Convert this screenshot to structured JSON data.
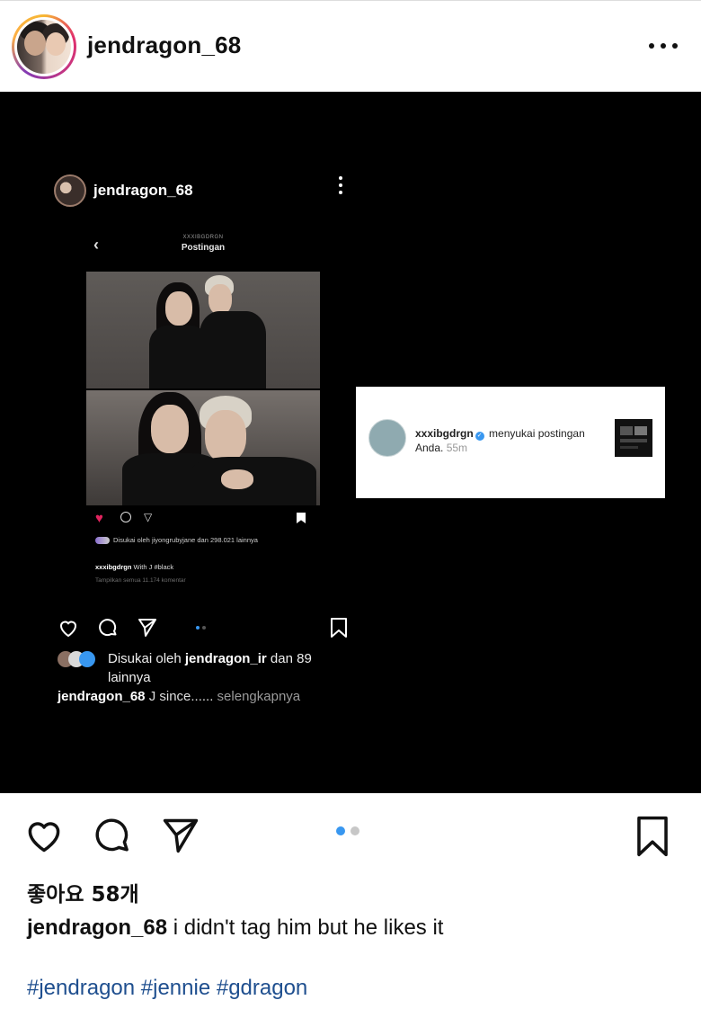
{
  "post": {
    "username": "jendragon_68",
    "likes_text": "좋아요 58개",
    "caption_user": "jendragon_68",
    "caption_text": " i didn't tag him but he likes it",
    "hashtags": "#jendragon #jennie #gdragon",
    "carousel": {
      "count": 2,
      "active": 0
    }
  },
  "inner_post": {
    "username": "jendragon_68",
    "likes_prefix": "Disukai oleh ",
    "likes_user": "jendragon_ir",
    "likes_suffix": " dan 89 lainnya",
    "caption_user": "jendragon_68",
    "caption_text": " J since......",
    "more_label": " selengkapnya"
  },
  "screenshot": {
    "account_label": "XXXIBGDRGN",
    "title": "Postingan",
    "likes_text": "Disukai oleh jiyongrubyjane dan 298.021 lainnya",
    "caption_user": "xxxibgdrgn",
    "caption_text": " With J #black",
    "comments_text": "Tampilkan semua 11.174 komentar"
  },
  "notification": {
    "user": "xxxibgdrgn",
    "action": " menyukai postingan Anda.",
    "time": " 55m"
  },
  "icons": {
    "outer": [
      "heart-icon",
      "comment-icon",
      "share-icon",
      "bookmark-icon",
      "more-icon"
    ]
  },
  "colors": {
    "hashtag": "#1f4f8f",
    "carousel_active": "#3897f0",
    "carousel_inactive": "#c7c7c7",
    "heart_liked": "#e0245e"
  }
}
